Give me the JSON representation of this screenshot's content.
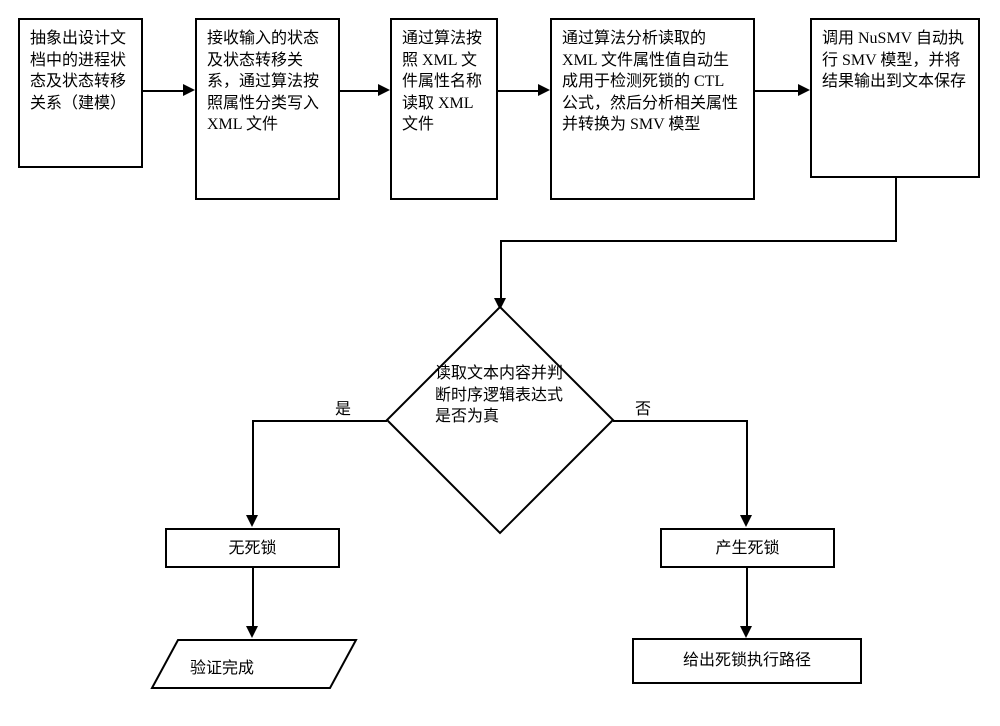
{
  "boxes": {
    "b1": "抽象出设计文档中的进程状态及状态转移关系（建模）",
    "b2": "接收输入的状态及状态转移关系，通过算法按照属性分类写入 XML 文件",
    "b3": "通过算法按照 XML 文件属性名称读取 XML 文件",
    "b4": "通过算法分析读取的 XML 文件属性值自动生成用于检测死锁的 CTL 公式，然后分析相关属性并转换为 SMV 模型",
    "b5": "调用 NuSMV 自动执行 SMV 模型，并将结果输出到文本保存",
    "no_deadlock": "无死锁",
    "has_deadlock": "产生死锁",
    "path": "给出死锁执行路径",
    "done": "验证完成"
  },
  "decision": "读取文本内容并判断时序逻辑表达式是否为真",
  "labels": {
    "yes": "是",
    "no": "否"
  }
}
